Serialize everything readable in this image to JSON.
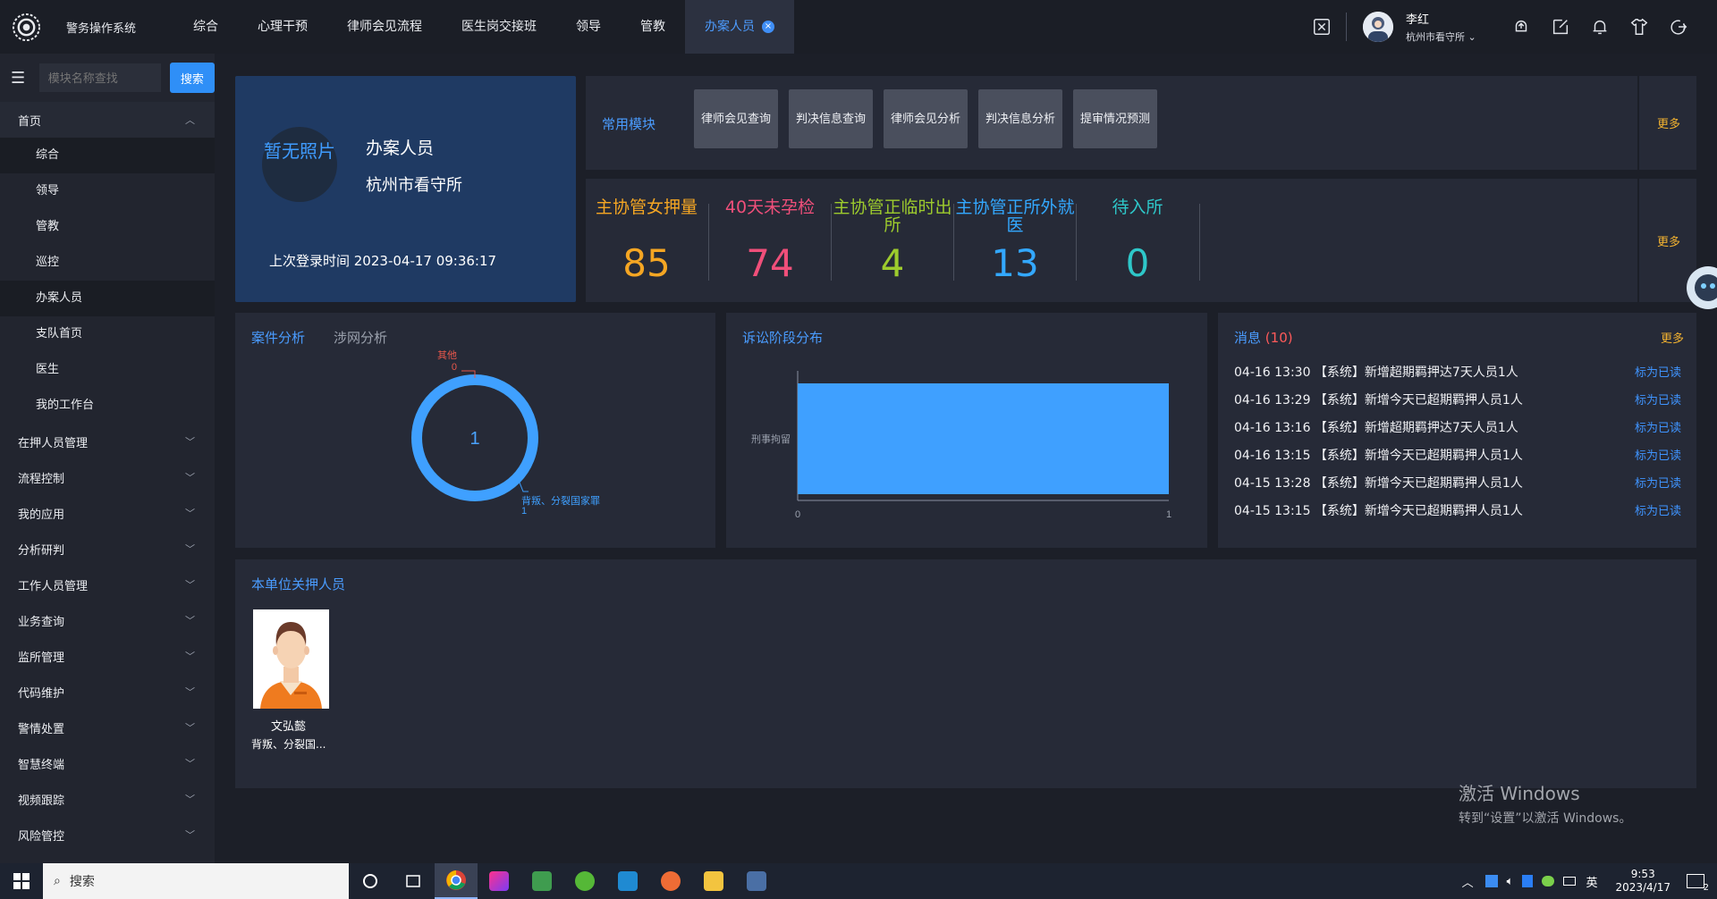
{
  "app": {
    "system_name": "警务操作系统"
  },
  "nav": {
    "tabs": [
      "综合",
      "心理干预",
      "律师会见流程",
      "医生岗交接班",
      "领导",
      "管教"
    ],
    "active_tab": "办案人员",
    "close_glyph": "×"
  },
  "user": {
    "name": "李红",
    "org": "杭州市看守所",
    "dropdown_glyph": "⌄"
  },
  "top_icons": [
    "fullscreen-exit-icon",
    "notification-up-icon",
    "edit-icon",
    "bell-icon",
    "shirt-icon",
    "logout-icon"
  ],
  "sidebar": {
    "menu_glyph": "☰",
    "search_placeholder": "模块名称查找",
    "search_button": "搜索",
    "home": {
      "label": "首页",
      "chevron": "︿",
      "children": [
        "综合",
        "领导",
        "管教",
        "巡控",
        "办案人员",
        "支队首页",
        "医生",
        "我的工作台"
      ]
    },
    "groups": [
      "在押人员管理",
      "流程控制",
      "我的应用",
      "分析研判",
      "工作人员管理",
      "业务查询",
      "监所管理",
      "代码维护",
      "警情处置",
      "智慧终端",
      "视频跟踪",
      "风险管控"
    ],
    "group_chevron": "﹀"
  },
  "profile": {
    "photo_placeholder": "暂无照片",
    "name": "办案人员",
    "org": "杭州市看守所",
    "last_login": "上次登录时间 2023-04-17 09:36:17"
  },
  "modules": {
    "title": "常用模块",
    "more": "更多",
    "items": [
      "律师会见查询",
      "判决信息查询",
      "律师会见分析",
      "判决信息分析",
      "提审情况预测"
    ]
  },
  "stats": {
    "more": "更多",
    "items": [
      {
        "label": "主协管女押量",
        "value": "85",
        "color": "#f5a623"
      },
      {
        "label": "40天未孕检",
        "value": "74",
        "color": "#f04f7a"
      },
      {
        "label": "主协管正临时出所",
        "value": "4",
        "color": "#9dcb2d"
      },
      {
        "label": "主协管正所外就医",
        "value": "13",
        "color": "#33a8ff"
      },
      {
        "label": "待入所",
        "value": "0",
        "color": "#2ec7c9"
      }
    ]
  },
  "case_analysis": {
    "tabs": [
      "案件分析",
      "涉网分析"
    ],
    "chart_data": {
      "type": "pie",
      "center_value": "1",
      "slices": [
        {
          "name": "其他",
          "value": 0,
          "color": "#e8574b"
        },
        {
          "name": "背叛、分裂国家罪",
          "value": 1,
          "color": "#3fa0ff"
        }
      ]
    }
  },
  "litigation": {
    "title": "诉讼阶段分布",
    "chart_data": {
      "type": "bar",
      "orientation": "horizontal",
      "categories": [
        "刑事拘留"
      ],
      "values": [
        1
      ],
      "xlim": [
        0,
        1
      ],
      "ticks": [
        "0",
        "1"
      ],
      "color": "#3fa0ff"
    }
  },
  "messages": {
    "title": "消息",
    "count": "(10)",
    "more": "更多",
    "items": [
      {
        "text": "04-16 13:30 【系统】新增超期羁押达7天人员1人",
        "action": "标为已读"
      },
      {
        "text": "04-16 13:29 【系统】新增今天已超期羁押人员1人",
        "action": "标为已读"
      },
      {
        "text": "04-16 13:16 【系统】新增超期羁押达7天人员1人",
        "action": "标为已读"
      },
      {
        "text": "04-16 13:15 【系统】新增今天已超期羁押人员1人",
        "action": "标为已读"
      },
      {
        "text": "04-15 13:28 【系统】新增今天已超期羁押人员1人",
        "action": "标为已读"
      },
      {
        "text": "04-15 13:15 【系统】新增今天已超期羁押人员1人",
        "action": "标为已读"
      }
    ]
  },
  "detainees": {
    "title": "本单位关押人员",
    "items": [
      {
        "name": "文弘懿",
        "crime": "背叛、分裂国..."
      }
    ]
  },
  "windows": {
    "activate_title": "激活 Windows",
    "activate_sub": "转到“设置”以激活 Windows。"
  },
  "taskbar": {
    "search_placeholder": "搜索",
    "ime": "英",
    "time": "9:53",
    "date": "2023/4/17",
    "notif_count": "2"
  }
}
